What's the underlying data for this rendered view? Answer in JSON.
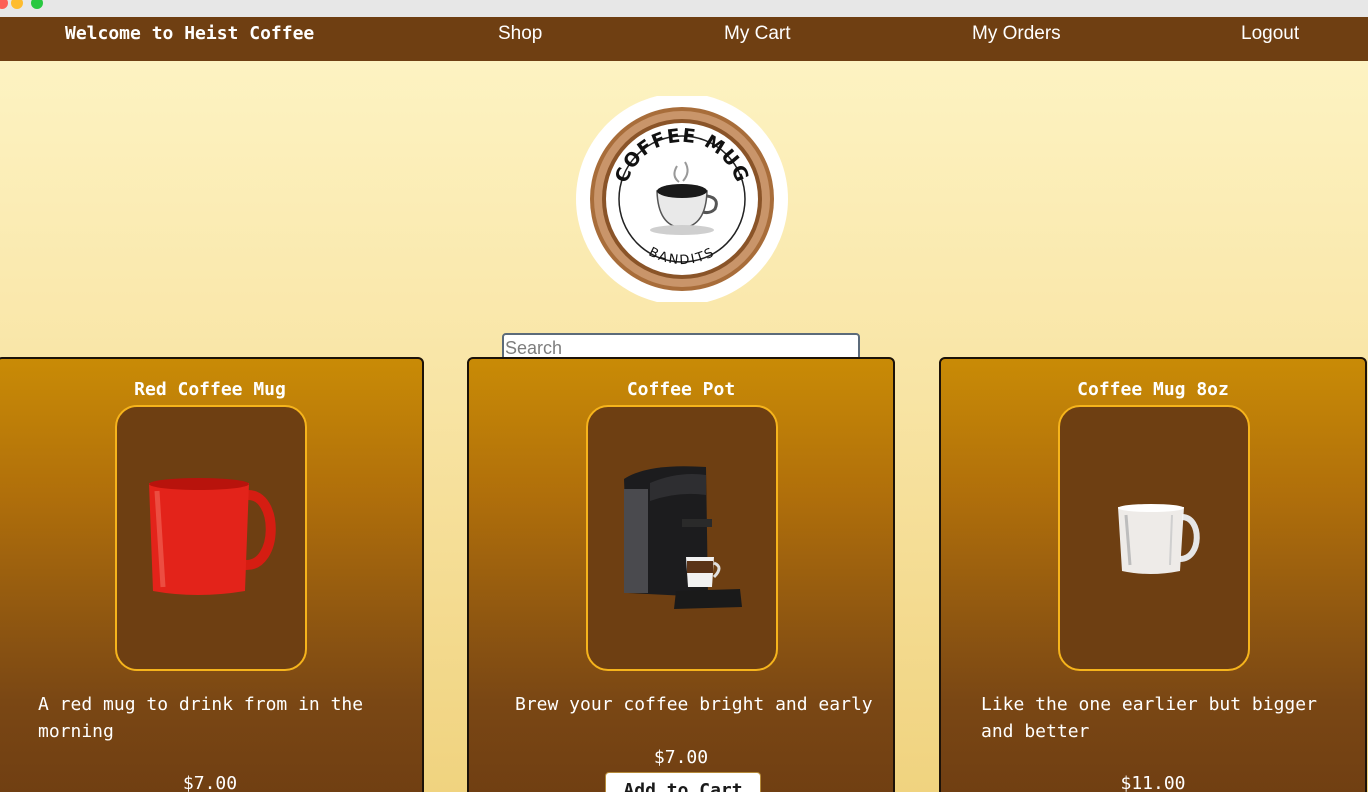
{
  "nav": {
    "brand": "Welcome to Heist Coffee",
    "links": [
      "Shop",
      "My Cart",
      "My Orders",
      "Logout"
    ]
  },
  "logo": {
    "top_text": "COFFEE MUG",
    "bottom_text": "BANDITS"
  },
  "search": {
    "placeholder": "Search",
    "value": ""
  },
  "products": [
    {
      "title": "Red Coffee Mug",
      "description": "A red mug to drink from in the\nmorning",
      "price": "$7.00",
      "image_icon": "red-mug-icon"
    },
    {
      "title": "Coffee Pot",
      "description": "Brew your coffee bright and early",
      "price": "$7.00",
      "button": "Add to Cart",
      "image_icon": "coffee-machine-icon"
    },
    {
      "title": "Coffee Mug 8oz",
      "description": "Like the one earlier but bigger\nand better",
      "price": "$11.00",
      "image_icon": "glass-mug-icon"
    }
  ],
  "colors": {
    "navbar": "#6f3f12",
    "card_top": "#c98b06",
    "card_bottom": "#6e3d12",
    "frame_border": "#f6b41c"
  }
}
